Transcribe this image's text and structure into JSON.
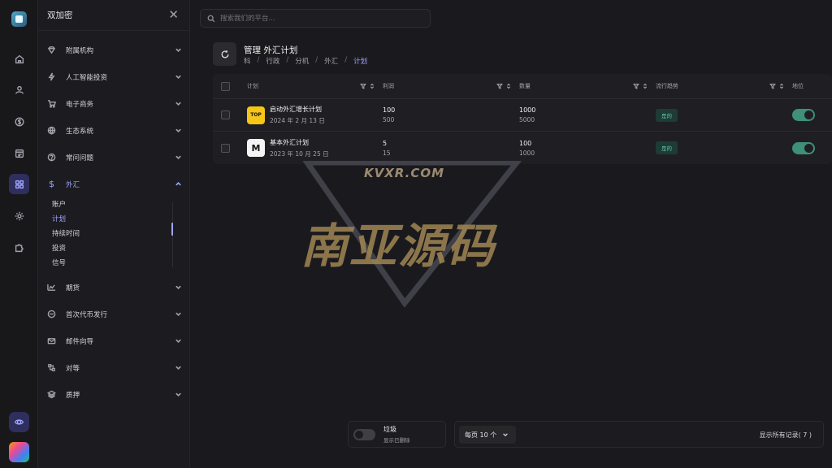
{
  "sidebar": {
    "title": "双加密",
    "menu": [
      {
        "label": "附属机构",
        "icon": "diamond-icon"
      },
      {
        "label": "人工智能投资",
        "icon": "bolt-icon"
      },
      {
        "label": "电子商务",
        "icon": "cart-icon"
      },
      {
        "label": "生态系统",
        "icon": "globe-icon"
      },
      {
        "label": "常问问题",
        "icon": "help-icon"
      },
      {
        "label": "外汇",
        "icon": "dollar-icon"
      },
      {
        "label": "期货",
        "icon": "chart-icon"
      },
      {
        "label": "首次代币发行",
        "icon": "coin-icon"
      },
      {
        "label": "邮件向导",
        "icon": "mail-icon"
      },
      {
        "label": "对等",
        "icon": "peer-icon"
      },
      {
        "label": "质押",
        "icon": "layers-icon"
      }
    ],
    "forex_sub": [
      "账户",
      "计划",
      "持续时间",
      "投资",
      "信号"
    ]
  },
  "search": {
    "placeholder": "搜索我们的平台..."
  },
  "page": {
    "title": "管理 外汇计划",
    "breadcrumb": [
      "科",
      "行政",
      "分机",
      "外汇",
      "计划"
    ]
  },
  "table": {
    "headers": {
      "plan": "计划",
      "profit": "利润",
      "amount": "数量",
      "trend": "流行趋势",
      "status": "地位"
    },
    "rows": [
      {
        "name": "启动外汇增长计划",
        "date": "2024 年 2 月 13 日",
        "logo": "TOP",
        "profit_top": "100",
        "profit_bot": "500",
        "amount_top": "1000",
        "amount_bot": "5000",
        "trend": "是的"
      },
      {
        "name": "基本外汇计划",
        "date": "2023 年 10 月 25 日",
        "logo": "M",
        "profit_top": "5",
        "profit_bot": "15",
        "amount_top": "100",
        "amount_bot": "1000",
        "trend": "是的"
      }
    ]
  },
  "watermark": {
    "site": "KVXR.COM",
    "text": "南亚源码"
  },
  "footer": {
    "trash_title": "垃圾",
    "trash_sub": "显示已删除",
    "per_page": "每页 10 个",
    "records": "显示所有记录( 7 )"
  },
  "colors": {
    "accent": "#9fa5ff",
    "success": "#3f8f7a",
    "background": "#1a1a1e"
  }
}
